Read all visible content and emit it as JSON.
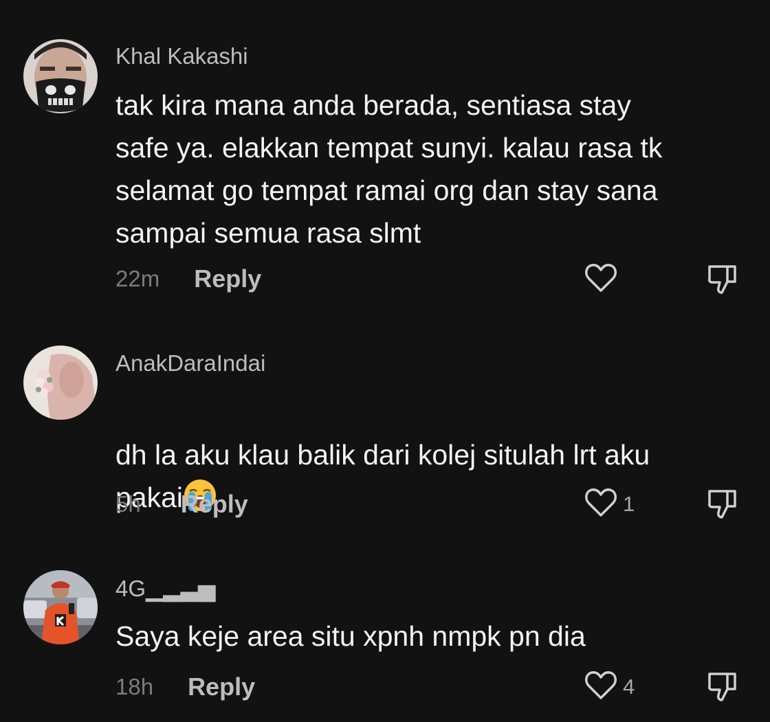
{
  "comments": [
    {
      "username": "Khal Kakashi",
      "text": "tak kira mana anda berada, sentiasa stay\nsafe ya. elakkan tempat sunyi. kalau rasa tk\nselamat go tempat ramai org dan stay sana\nsampai semua rasa slmt",
      "time": "22m",
      "reply_label": "Reply",
      "likes": ""
    },
    {
      "username": "AnakDaraIndai",
      "text": "dh la aku klau balik dari kolej situlah lrt aku\npakai",
      "emoji": "loudly-crying-face",
      "time": "5h",
      "reply_label": "Reply",
      "likes": "1"
    },
    {
      "username": "4G▁▂▃▅",
      "text": "Saya keje area situ xpnh nmpk pn dia",
      "time": "18h",
      "reply_label": "Reply",
      "likes": "4"
    }
  ],
  "icons": {
    "like": "heart-outline-icon",
    "dislike": "thumbs-down-icon"
  },
  "colors": {
    "background": "#121212",
    "text": "#f4f4f4",
    "username": "#bdbdbd",
    "time": "#7c7c7c"
  }
}
